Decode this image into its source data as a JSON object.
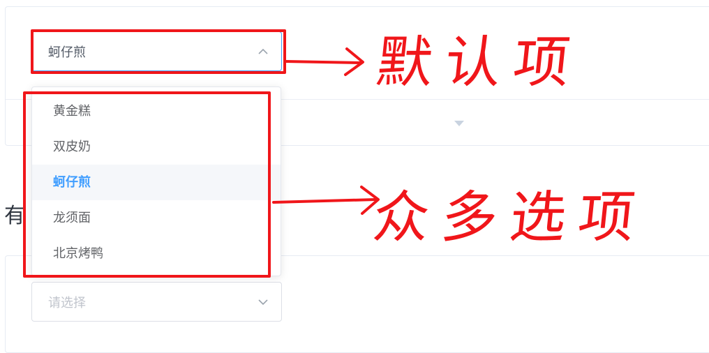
{
  "select_default": {
    "value": "蚵仔煎"
  },
  "dropdown": {
    "options": [
      {
        "label": "黄金糕"
      },
      {
        "label": "双皮奶"
      },
      {
        "label": "蚵仔煎"
      },
      {
        "label": "龙须面"
      },
      {
        "label": "北京烤鸭"
      }
    ],
    "selected_index": 2
  },
  "section_title": "有",
  "select_empty": {
    "placeholder": "请选择"
  },
  "annotations": {
    "default_label": "默认项",
    "options_label": "众多选项",
    "color": "#f0161a"
  },
  "colors": {
    "accent": "#409eff",
    "placeholder": "#c0c4cc"
  }
}
